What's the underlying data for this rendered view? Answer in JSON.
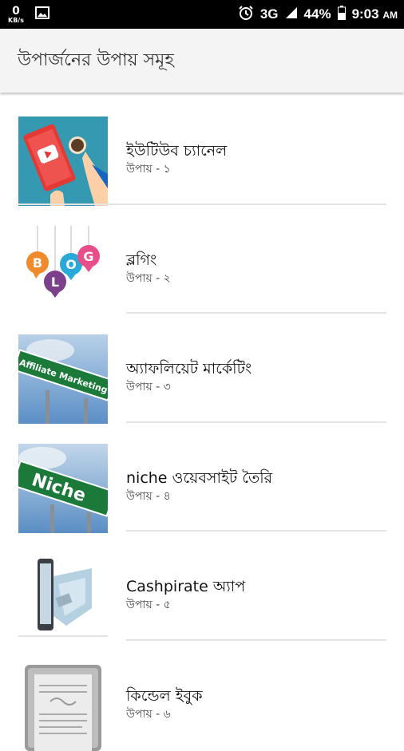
{
  "status_bar": {
    "net_speed_value": "0",
    "net_speed_unit": "KB/s",
    "network": "3G",
    "battery": "44%",
    "time": "9:03",
    "ampm": "AM",
    "icons": [
      "image-icon",
      "alarm-icon",
      "signal-icon",
      "battery-icon"
    ]
  },
  "app_bar": {
    "title": "উপার্জনের উপায় সমূহ"
  },
  "items": [
    {
      "title": "ইউটিউব চ্যানেল",
      "subtitle": "উপায় - ১",
      "thumb": "youtube-tablet-image"
    },
    {
      "title": "ব্লগিং",
      "subtitle": "উপায় - ২",
      "thumb": "blog-bubbles-image"
    },
    {
      "title": "অ্যাফলিয়েট মার্কেটিং",
      "subtitle": "উপায় - ৩",
      "thumb": "affiliate-marketing-sign-image",
      "sign_text": "Affiliate Marketing"
    },
    {
      "title": "niche ওয়েবসাইট তৈরি",
      "subtitle": "উপায় - ৪",
      "thumb": "niche-sign-image",
      "sign_text": "Niche"
    },
    {
      "title": "Cashpirate অ্যাপ",
      "subtitle": "উপায় - ৫",
      "thumb": "phone-cash-image"
    },
    {
      "title": "কিন্ডেল ইবুক",
      "subtitle": "উপায় - ৬",
      "thumb": "kindle-ereader-image"
    }
  ],
  "colors": {
    "status_bar": "#000000",
    "app_bar": "#f4f4f4",
    "divider": "#e4e4e4",
    "youtube_red": "#e53935",
    "sign_green": "#1b7a3a",
    "sky": "#6f9fd0"
  }
}
